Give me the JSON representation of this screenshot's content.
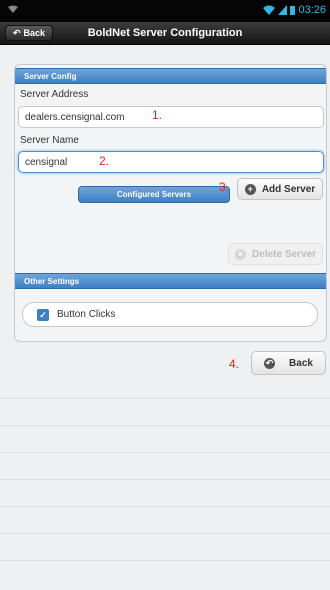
{
  "status_bar": {
    "time": "03:26"
  },
  "app_bar": {
    "back_label": "Back",
    "title": "BoldNet Server Configuration"
  },
  "server_config": {
    "header": "Server Config",
    "address_label": "Server Address",
    "address_value": "dealers.censignal.com",
    "name_label": "Server Name",
    "name_value": "censignal",
    "add_button": "Add Server",
    "configured_button": "Configured Servers",
    "delete_button": "Delete Server"
  },
  "other_settings": {
    "header": "Other Settings",
    "button_clicks_label": "Button Clicks",
    "button_clicks_checked": true
  },
  "back_button": "Back",
  "steps": {
    "s1": "1.",
    "s2": "2.",
    "s3": "3.",
    "s4": "4."
  },
  "colors": {
    "accent": "#3d80c6",
    "annotation": "#e0251b",
    "status_icon": "#33b5e5"
  }
}
